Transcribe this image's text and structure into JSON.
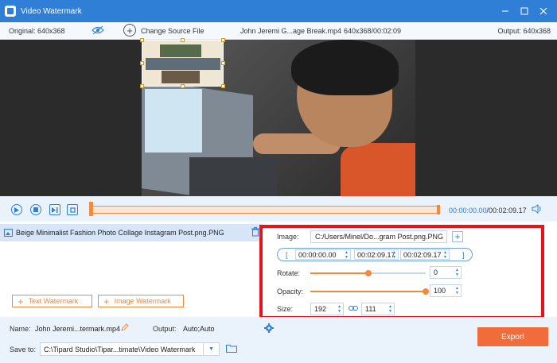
{
  "window": {
    "title": "Video Watermark",
    "minimize_icon": "minimize-icon",
    "maximize_icon": "maximize-icon",
    "close_icon": "close-icon"
  },
  "infobar": {
    "original": "Original: 640x368",
    "change_source": "Change Source File",
    "file_name": "John Jeremi G...age Break.mp4",
    "file_info": "640x368/00:02:09",
    "output": "Output: 640x368"
  },
  "playback": {
    "current_time": "00:00:00.00",
    "duration": "/00:02:09.17"
  },
  "watermark_list": {
    "items": [
      {
        "name": "Beige Minimalist Fashion Photo Collage Instagram Post.png.PNG"
      }
    ],
    "add_text_label": "Text Watermark",
    "add_image_label": "Image Watermark"
  },
  "settings": {
    "image_label": "Image:",
    "image_path": "C:/Users/Minel/Do...gram Post.png.PNG",
    "start_time": "00:00:00.00",
    "end_time": "00:02:09.17",
    "duration_time": "00:02:09.17",
    "rotate_label": "Rotate:",
    "rotate_value": "0",
    "rotate_level": 0.5,
    "opacity_label": "Opacity:",
    "opacity_value": "100",
    "opacity_level": 1.0,
    "size_label": "Size:",
    "width": "192",
    "height": "111"
  },
  "bottom": {
    "name_label": "Name:",
    "name_value": "John Jeremi...termark.mp4",
    "output_label": "Output:",
    "output_value": "Auto;Auto",
    "save_label": "Save to:",
    "save_path": "C:\\Tipard Studio\\Tipar...timate\\Video Watermark",
    "export_label": "Export"
  },
  "colors": {
    "accent": "#2f7fd6",
    "orange": "#f08a3c",
    "export": "#f26b3a",
    "highlight_box": "#e3141b"
  }
}
